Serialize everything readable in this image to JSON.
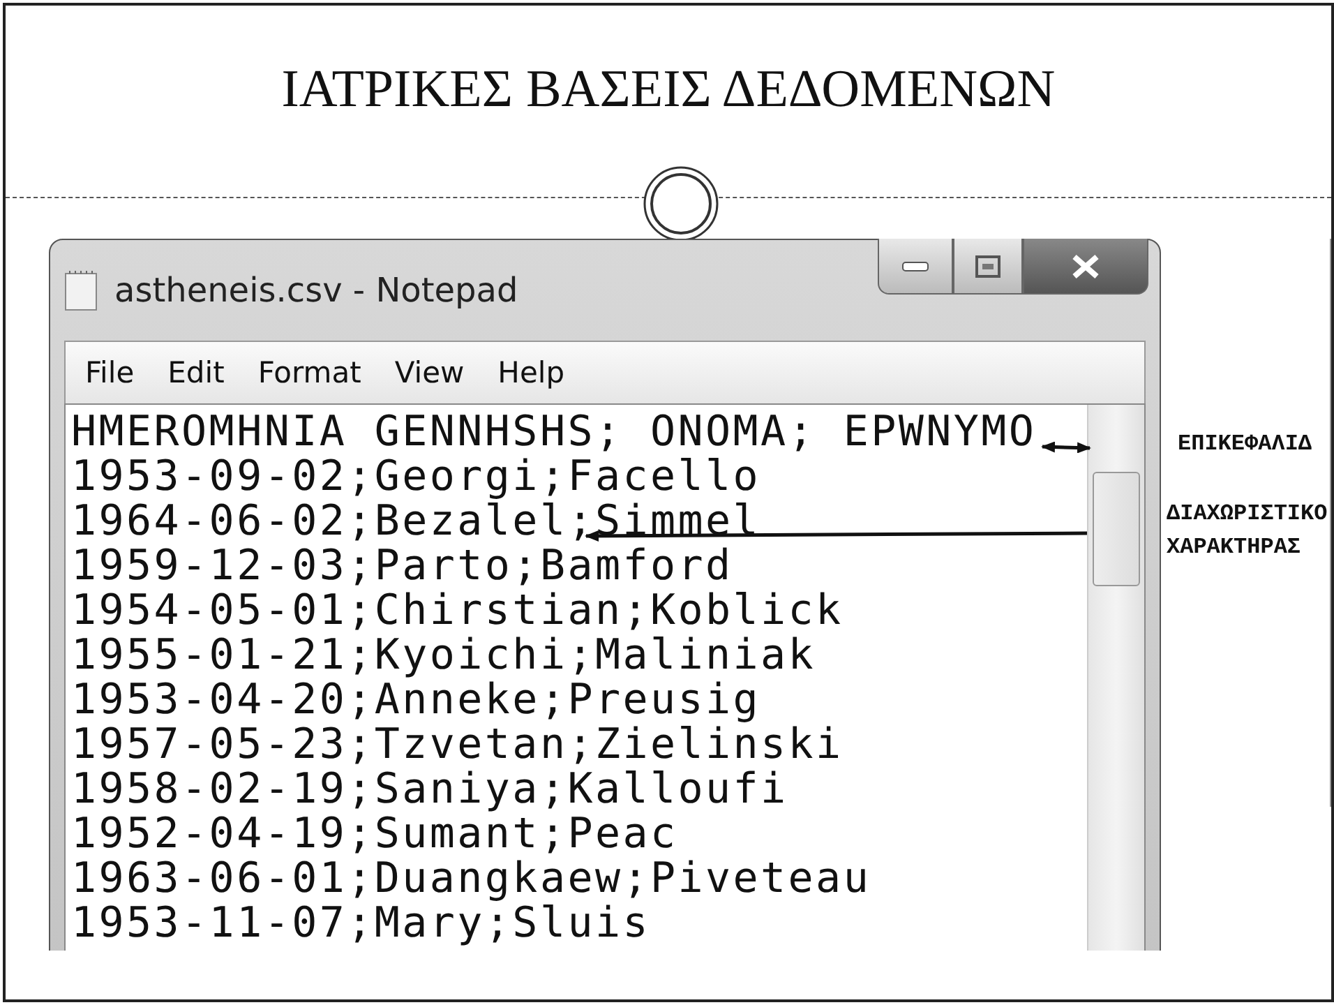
{
  "slide": {
    "title": "ΙΑΤΡΙΚΕΣ ΒΑΣΕΙΣ ΔΕΔΟΜΕΝΩΝ"
  },
  "window": {
    "title": "astheneis.csv - Notepad"
  },
  "menu": [
    "File",
    "Edit",
    "Format",
    "View",
    "Help"
  ],
  "lines": [
    "HMEROMHNIA GENNHSHS; ONOMA; EPWNYMO",
    "1953-09-02;Georgi;Facello",
    "1964-06-02;Bezalel;Simmel",
    "1959-12-03;Parto;Bamford",
    "1954-05-01;Chirstian;Koblick",
    "1955-01-21;Kyoichi;Maliniak",
    "1953-04-20;Anneke;Preusig",
    "1957-05-23;Tzvetan;Zielinski",
    "1958-02-19;Saniya;Kalloufi",
    "1952-04-19;Sumant;Peac",
    "1963-06-01;Duangkaew;Piveteau",
    "1953-11-07;Mary;Sluis"
  ],
  "annotations": [
    {
      "lines": [
        "ΕΠΙΚΕΦΑΛΙΔ"
      ]
    },
    {
      "lines": [
        "ΔΙΑΧΩΡΙΣΤΙΚΟ",
        "ΧΑΡΑΚΤΗΡΑΣ"
      ]
    }
  ]
}
